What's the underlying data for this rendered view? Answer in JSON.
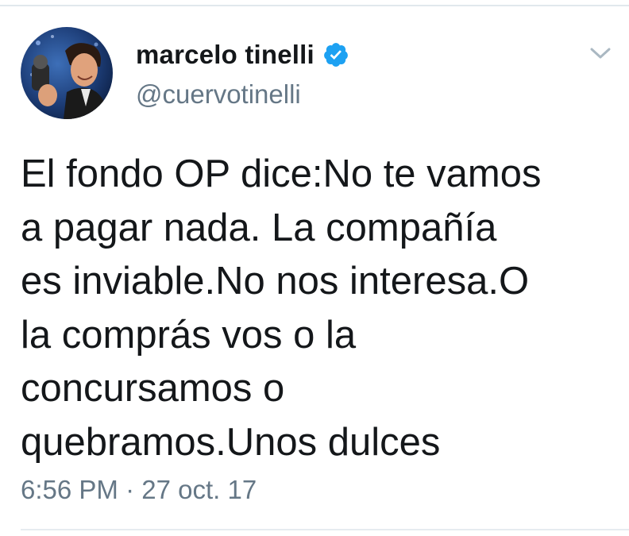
{
  "tweet": {
    "author": {
      "display_name": "marcelo tinelli",
      "handle": "@cuervotinelli",
      "verified": true,
      "avatar_icon": "profile-photo"
    },
    "text": "El fondo OP dice:No te vamos\na pagar nada. La compañía\nes inviable.No nos interesa.O\nla comprás vos o la\nconcursamos o\nquebramos.Unos dulces",
    "time": "6:56 PM",
    "separator": "·",
    "date": "27 oct. 17",
    "menu_icon": "chevron-down-icon"
  },
  "colors": {
    "text_primary": "#14171a",
    "text_secondary": "#657786",
    "verified_badge": "#1da1f2",
    "divider": "#e1e8ed"
  }
}
